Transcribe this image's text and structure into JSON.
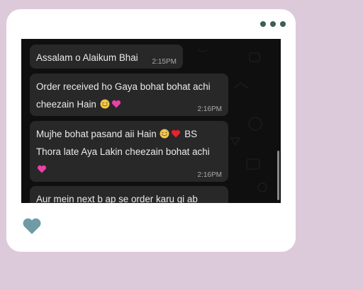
{
  "menu_icon": "more-horizontal-icon",
  "messages": [
    {
      "text": "Assalam o Alaikum Bhai",
      "time": "2:15PM"
    },
    {
      "text_line1": "Order received ho Gaya bohat bohat achi",
      "text_line2": "cheezain Hain",
      "time": "2:16PM",
      "emojis": [
        "grin-sweat-emoji",
        "pink-heart-emoji"
      ]
    },
    {
      "text_line1a": "Mujhe bohat pasand aii Hain",
      "text_line1b": "BS",
      "text_line2": "Thora late Aya Lakin cheezain bohat achi",
      "time": "2:16PM",
      "emojis": [
        "grin-sweat-emoji",
        "red-heart-emoji",
        "pink-heart-emoji"
      ]
    },
    {
      "text": "Aur mein next b ap se order karu gi ab"
    }
  ],
  "like_icon": "heart-icon",
  "colors": {
    "page_bg": "#dccadb",
    "card_bg": "#ffffff",
    "chat_bg": "#0f0f0f",
    "bubble_bg": "#282828",
    "heart": "#6f9ba6",
    "dots": "#3d5f52"
  }
}
